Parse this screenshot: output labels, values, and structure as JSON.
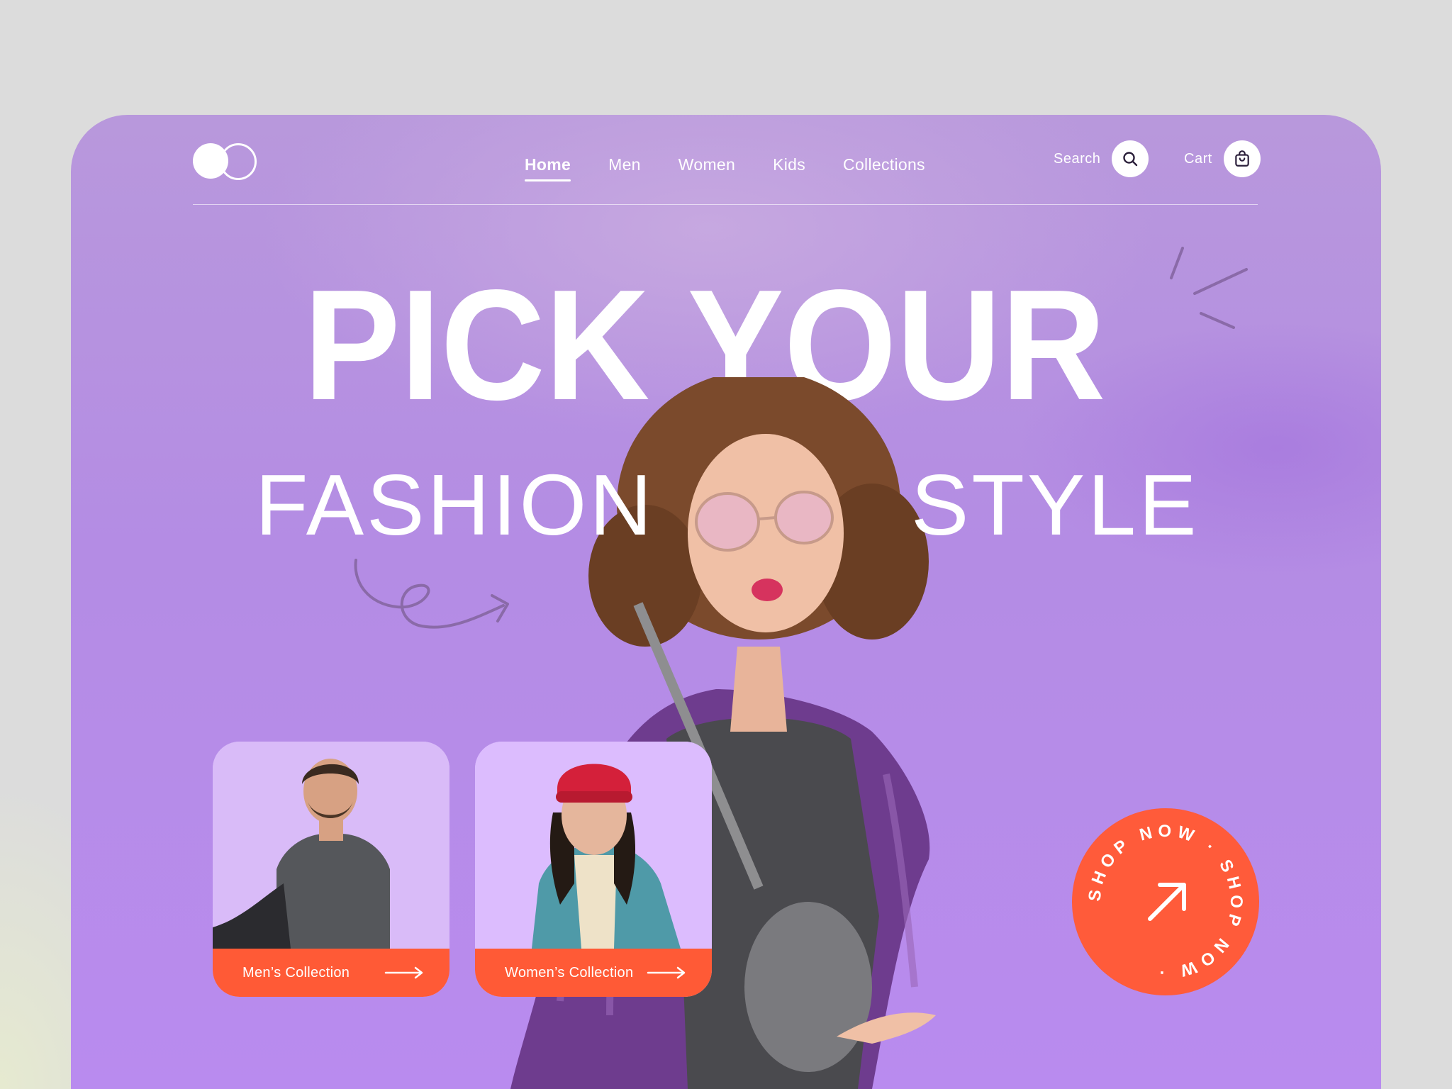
{
  "nav": {
    "items": [
      {
        "label": "Home",
        "active": true
      },
      {
        "label": "Men",
        "active": false
      },
      {
        "label": "Women",
        "active": false
      },
      {
        "label": "Kids",
        "active": false
      },
      {
        "label": "Collections",
        "active": false
      }
    ]
  },
  "header": {
    "search_label": "Search",
    "cart_label": "Cart",
    "icons": [
      "search-icon",
      "shopping-bag-icon"
    ]
  },
  "hero": {
    "line1": "PICK YOUR",
    "line2_left": "FASHION",
    "line2_right": "STYLE"
  },
  "cards": [
    {
      "label": "Men’s Collection"
    },
    {
      "label": "Women’s Collection"
    }
  ],
  "badge": {
    "ring_text": "SHOP NOW · SHOP NOW ·"
  },
  "colors": {
    "accent": "#ff5a36",
    "background": "#b48ce4",
    "card_bg": "#dcbcfe",
    "text": "#ffffff"
  }
}
